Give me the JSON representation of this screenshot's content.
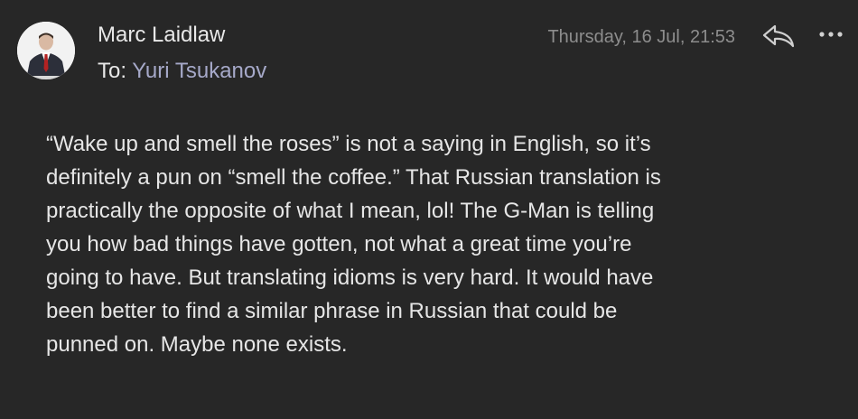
{
  "header": {
    "sender_name": "Marc Laidlaw",
    "recipient_prefix": "To:",
    "recipient_name": "Yuri Tsukanov",
    "timestamp": "Thursday, 16 Jul, 21:53",
    "avatar_icon": "person-avatar-icon",
    "reply_icon": "reply-icon",
    "more_icon": "more-options-icon"
  },
  "body": {
    "lines": [
      "“Wake up and smell the roses” is not a saying in English, so it’s",
      "definitely a pun on “smell the coffee.” That Russian translation is",
      "practically the opposite of what I mean, lol! The G-Man is telling",
      "you how bad things have gotten, not what a great time you’re",
      "going to have. But translating idioms is very hard. It would have",
      "been better to find a similar phrase in Russian that could be",
      "punned on. Maybe none exists."
    ]
  },
  "colors": {
    "background": "#272727",
    "text": "#e6e6e6",
    "recipient": "#a6a9c9",
    "muted": "#8d8d8d"
  }
}
